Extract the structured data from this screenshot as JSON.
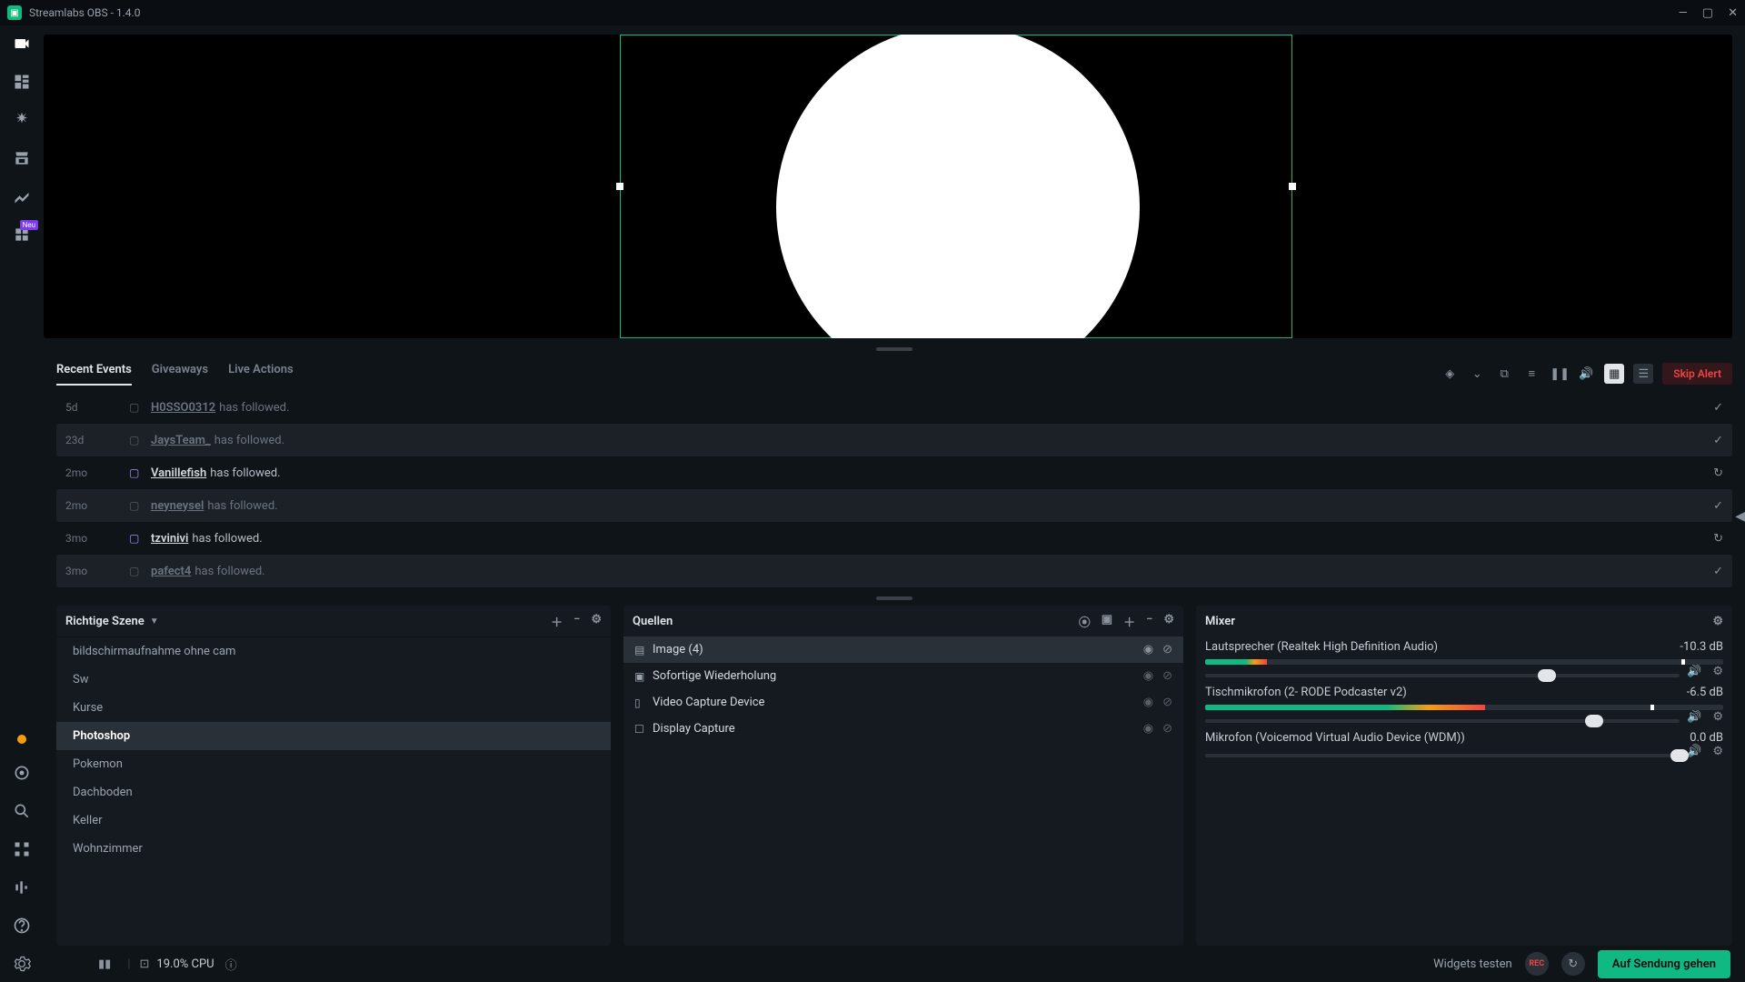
{
  "window": {
    "title": "Streamlabs OBS - 1.4.0"
  },
  "nav": {
    "new_badge": "Neu"
  },
  "events_tabs": {
    "recent": "Recent Events",
    "giveaways": "Giveaways",
    "live_actions": "Live Actions"
  },
  "events_toolbar": {
    "skip": "Skip Alert"
  },
  "events": [
    {
      "time": "5d",
      "user": "H0SSO0312",
      "action": "has followed.",
      "muted": true,
      "status": "check"
    },
    {
      "time": "23d",
      "user": "JaysTeam_",
      "action": "has followed.",
      "muted": true,
      "status": "check"
    },
    {
      "time": "2mo",
      "user": "Vanillefish",
      "action": "has followed.",
      "muted": false,
      "status": "refresh"
    },
    {
      "time": "2mo",
      "user": "neyneysel",
      "action": "has followed.",
      "muted": true,
      "status": "check"
    },
    {
      "time": "3mo",
      "user": "tzvinivi",
      "action": "has followed.",
      "muted": false,
      "status": "refresh"
    },
    {
      "time": "3mo",
      "user": "pafect4",
      "action": "has followed.",
      "muted": true,
      "status": "check"
    }
  ],
  "scenes_panel": {
    "title": "Richtige Szene"
  },
  "scenes": [
    {
      "name": "bildschirmaufnahme ohne cam",
      "active": false
    },
    {
      "name": "Sw",
      "active": false
    },
    {
      "name": "Kurse",
      "active": false
    },
    {
      "name": "Photoshop",
      "active": true
    },
    {
      "name": "Pokemon",
      "active": false
    },
    {
      "name": "Dachboden",
      "active": false
    },
    {
      "name": "Keller",
      "active": false
    },
    {
      "name": "Wohnzimmer",
      "active": false
    }
  ],
  "sources_panel": {
    "title": "Quellen"
  },
  "sources": [
    {
      "icon": "image",
      "name": "Image (4)",
      "active": true
    },
    {
      "icon": "replay",
      "name": "Sofortige Wiederholung",
      "active": false
    },
    {
      "icon": "camera",
      "name": "Video Capture Device",
      "active": false
    },
    {
      "icon": "monitor",
      "name": "Display Capture",
      "active": false
    }
  ],
  "mixer_panel": {
    "title": "Mixer"
  },
  "mixer": [
    {
      "name": "Lautsprecher (Realtek High Definition Audio)",
      "db": "-10.3 dB",
      "meter_pct": 12,
      "peak_pct": 92,
      "slider_pct": 72,
      "show_meter": true
    },
    {
      "name": "Tischmikrofon (2- RODE Podcaster v2)",
      "db": "-6.5 dB",
      "meter_pct": 54,
      "peak_pct": 86,
      "slider_pct": 82,
      "show_meter": true
    },
    {
      "name": "Mikrofon (Voicemod Virtual Audio Device (WDM))",
      "db": "0.0 dB",
      "meter_pct": 0,
      "peak_pct": 0,
      "slider_pct": 100,
      "show_meter": false
    }
  ],
  "statusbar": {
    "cpu": "19.0% CPU",
    "widgets_test": "Widgets testen",
    "go_live": "Auf Sendung gehen",
    "rec": "REC"
  },
  "colors": {
    "accent": "#10b981",
    "danger": "#ef4444"
  }
}
